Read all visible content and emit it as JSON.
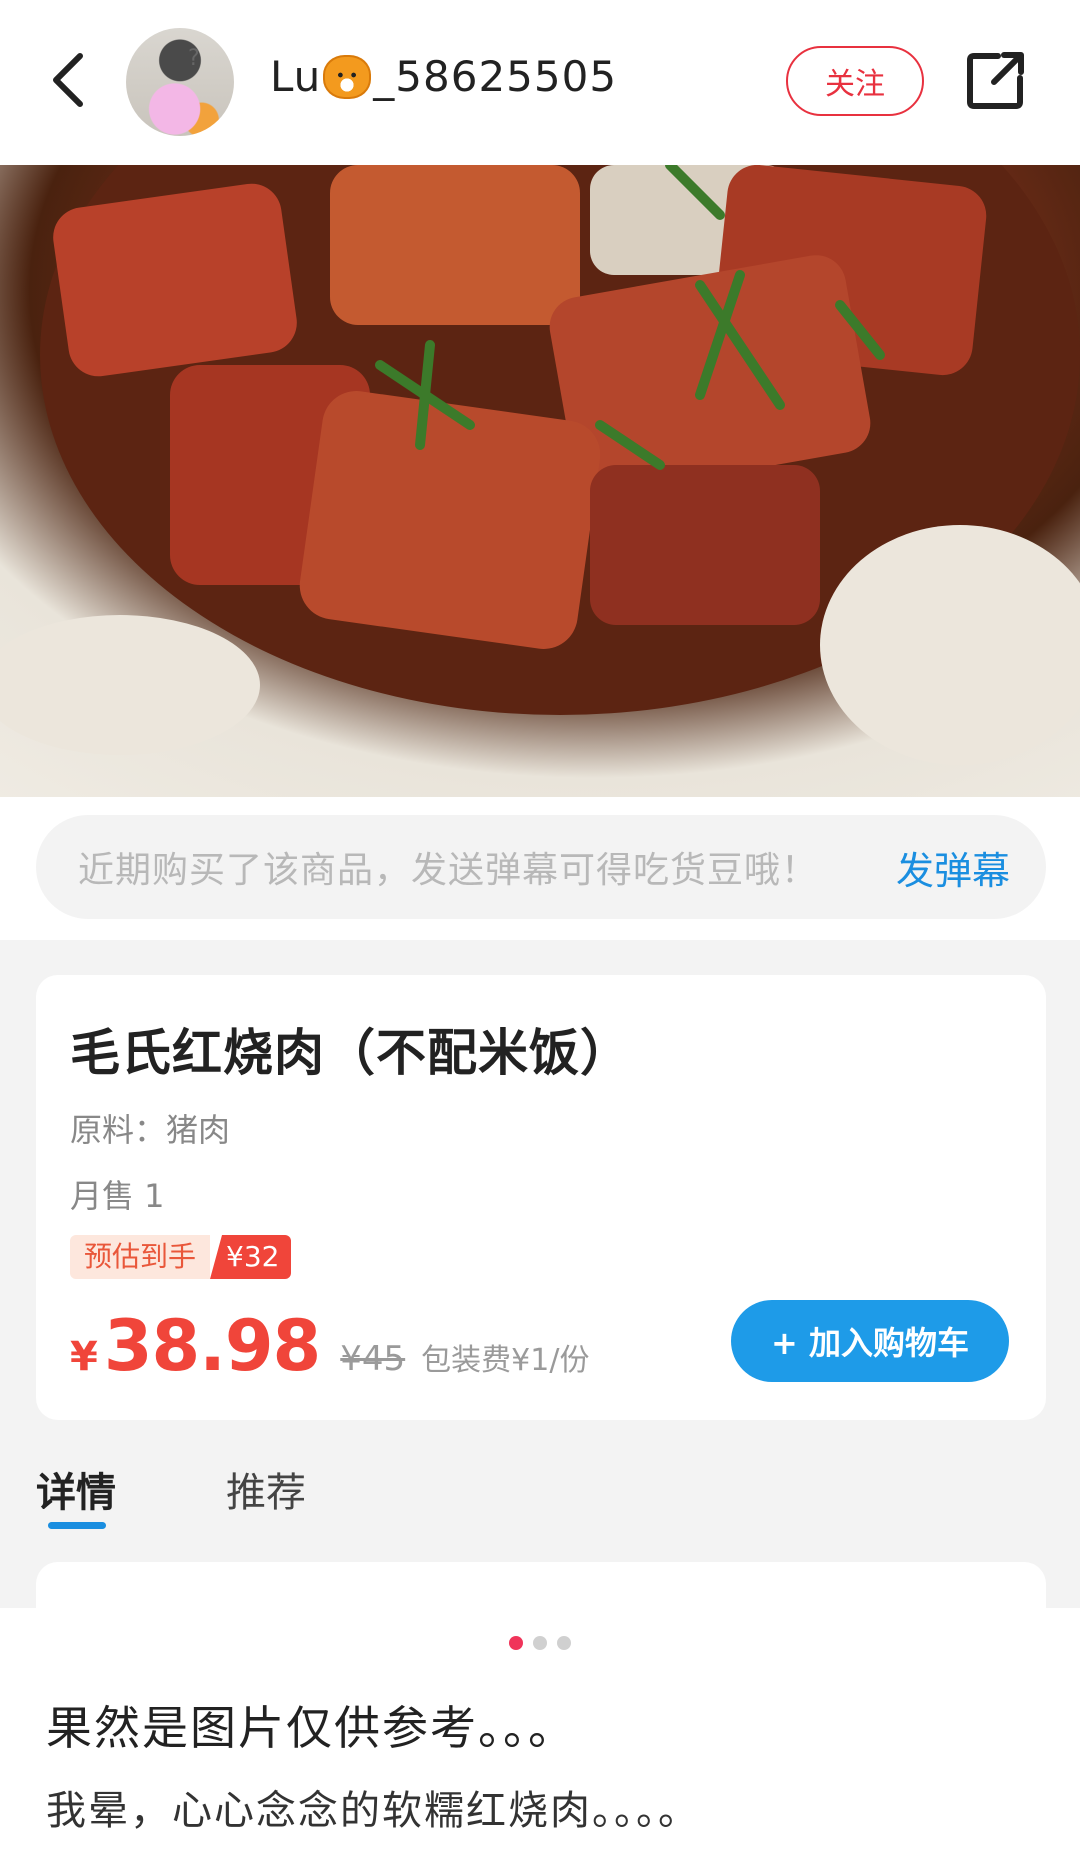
{
  "header": {
    "username_prefix": "Lu",
    "username_suffix": "_58625505",
    "follow_label": "关注"
  },
  "danmaku": {
    "hint": "近期购买了该商品，发送弹幕可得吃货豆哦！",
    "send_label": "发弹幕"
  },
  "product": {
    "title": "毛氏红烧肉（不配米饭）",
    "ingredients": "原料：猪肉",
    "monthly_sales": "月售 1",
    "estimate_label": "预估到手",
    "estimate_price": "¥32",
    "currency": "¥",
    "price": "38.98",
    "original_price": "¥45",
    "packaging_fee": "包装费¥1/份",
    "add_to_cart_label": "+ 加入购物车"
  },
  "tabs": [
    {
      "label": "详情",
      "active": true
    },
    {
      "label": "推荐",
      "active": false
    }
  ],
  "carousel": {
    "total": 3,
    "active_index": 0
  },
  "post": {
    "title": "果然是图片仅供参考。。。",
    "text": "我晕，心心念念的软糯红烧肉。。。。"
  },
  "colors": {
    "accent_red": "#f0453a",
    "accent_blue": "#1e9be8",
    "follow_red": "#e8313f"
  }
}
